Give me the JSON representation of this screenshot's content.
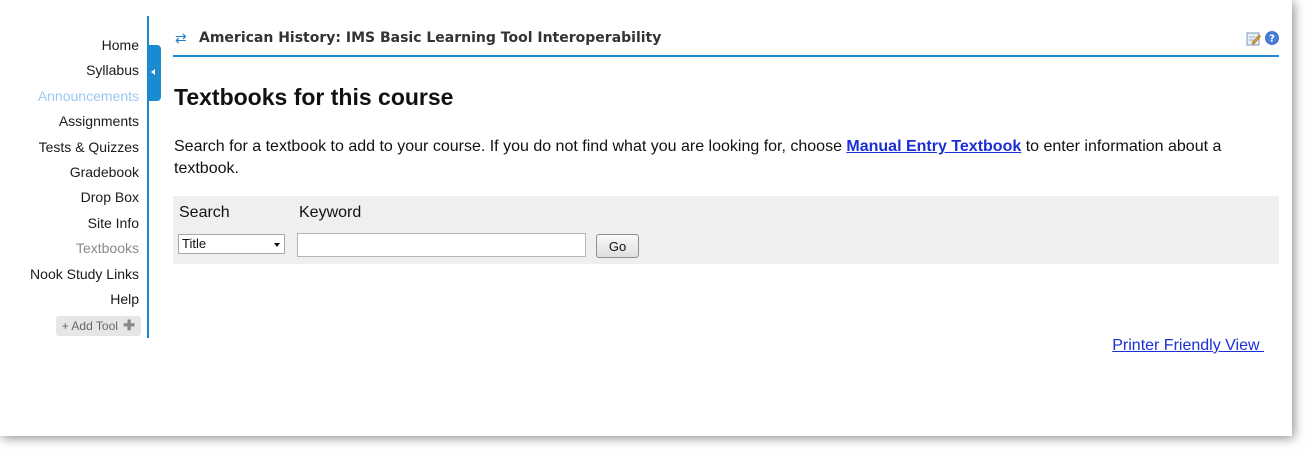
{
  "sidebar": {
    "items": [
      {
        "label": "Home",
        "state": "normal"
      },
      {
        "label": "Syllabus",
        "state": "normal"
      },
      {
        "label": "Announcements",
        "state": "active"
      },
      {
        "label": "Assignments",
        "state": "normal"
      },
      {
        "label": "Tests & Quizzes",
        "state": "normal"
      },
      {
        "label": "Gradebook",
        "state": "normal"
      },
      {
        "label": "Drop Box",
        "state": "normal"
      },
      {
        "label": "Site Info",
        "state": "normal"
      },
      {
        "label": "Textbooks",
        "state": "current"
      },
      {
        "label": "Nook Study Links",
        "state": "normal"
      },
      {
        "label": "Help",
        "state": "normal"
      }
    ],
    "add_tool_label": "+ Add Tool",
    "add_tool_icon": "plus-icon"
  },
  "titlebar": {
    "title": "American History: IMS Basic Learning Tool Interoperability",
    "reset_icon": "reset-icon",
    "edit_icon": "edit-icon",
    "help_icon": "help-icon"
  },
  "main": {
    "heading": "Textbooks for this course",
    "instructions_before": "Search for a textbook to add to your course. If you do not find what you are looking for, choose ",
    "instructions_link": "Manual Entry Textbook",
    "instructions_after": " to enter information about a textbook.",
    "search": {
      "search_label": "Search",
      "keyword_label": "Keyword",
      "selected_field": "Title",
      "keyword_value": "",
      "go_label": "Go"
    },
    "printer_link": "Printer Friendly View "
  },
  "colors": {
    "accent": "#1a8ad1",
    "link": "#1a2fd6",
    "active_nav": "#9dc8ef",
    "panel": "#efefef"
  }
}
